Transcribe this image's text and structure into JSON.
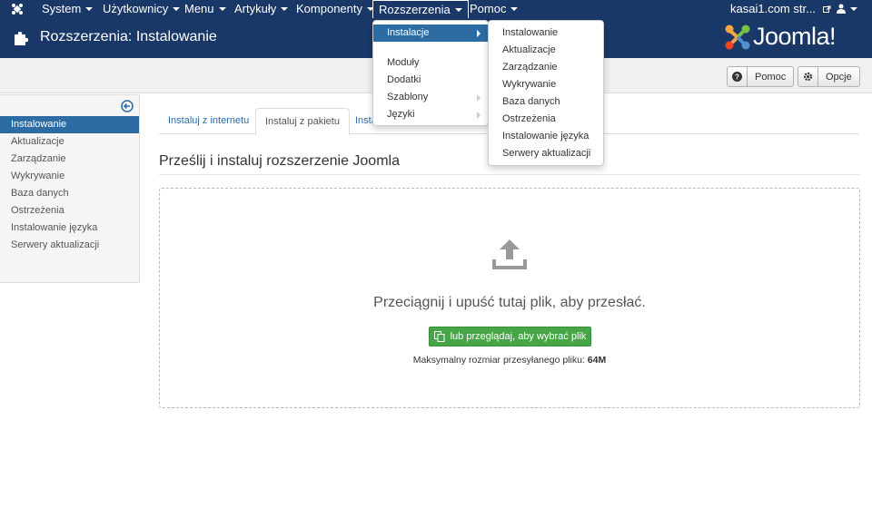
{
  "navbar": {
    "items": [
      {
        "label": "System"
      },
      {
        "label": "Użytkownicy"
      },
      {
        "label": "Menu"
      },
      {
        "label": "Artykuły"
      },
      {
        "label": "Komponenty"
      },
      {
        "label": "Rozszerzenia"
      },
      {
        "label": "Pomoc"
      }
    ],
    "site_link": "kasai1.com str...",
    "logo_icon": "joomla-icon",
    "user_icon": "user-icon"
  },
  "header": {
    "title": "Rozszerzenia: Instalowanie",
    "icon": "puzzle-icon",
    "logo_text": "Joomla!"
  },
  "toolbar": {
    "help_label": "Pomoc",
    "options_label": "Opcje"
  },
  "sidebar": {
    "items": [
      {
        "label": "Instalowanie",
        "active": true
      },
      {
        "label": "Aktualizacje"
      },
      {
        "label": "Zarządzanie"
      },
      {
        "label": "Wykrywanie"
      },
      {
        "label": "Baza danych"
      },
      {
        "label": "Ostrzeżenia"
      },
      {
        "label": "Instalowanie języka"
      },
      {
        "label": "Serwery aktualizacji"
      }
    ]
  },
  "tabs": [
    {
      "label": "Instaluj z internetu"
    },
    {
      "label": "Instaluj z pakietu",
      "active": true
    },
    {
      "label": "Instal"
    }
  ],
  "main": {
    "section_title": "Prześlij i instaluj rozszerzenie Joomla",
    "drop_text": "Przeciągnij i upuść tutaj plik, aby przesłać.",
    "browse_label": "lub przeglądaj, aby wybrać plik",
    "max_size_label": "Maksymalny rozmiar przesyłanego pliku:",
    "max_size_value": "64M"
  },
  "extensions_menu": {
    "items": [
      {
        "label": "Instalacje",
        "active": true,
        "submenu": true
      },
      {
        "label": "Moduły"
      },
      {
        "label": "Dodatki"
      },
      {
        "label": "Szablony",
        "submenu": true
      },
      {
        "label": "Języki",
        "submenu": true
      }
    ]
  },
  "install_submenu": {
    "items": [
      {
        "label": "Instalowanie"
      },
      {
        "label": "Aktualizacje"
      },
      {
        "label": "Zarządzanie"
      },
      {
        "label": "Wykrywanie"
      },
      {
        "label": "Baza danych"
      },
      {
        "label": "Ostrzeżenia"
      },
      {
        "label": "Instalowanie języka"
      },
      {
        "label": "Serwery aktualizacji"
      }
    ]
  },
  "colors": {
    "navbar_bg": "#1a3867",
    "accent_blue": "#2d6ca2",
    "success_green": "#46a546"
  }
}
